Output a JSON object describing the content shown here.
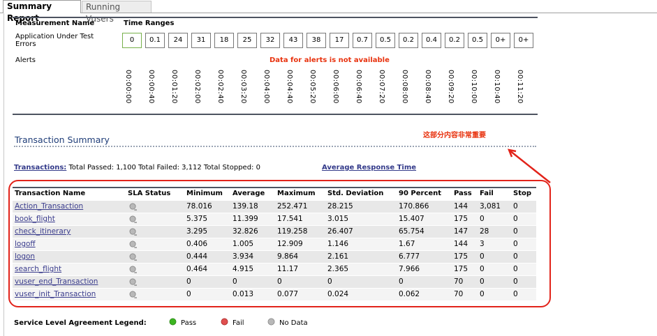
{
  "tabs": [
    {
      "label": "Summary Report",
      "active": true
    },
    {
      "label": "Running Vusers",
      "active": false
    }
  ],
  "measurement": {
    "header_name": "Measurement Name",
    "header_ranges": "Time Ranges",
    "app_errors_label": "Application Under Test\nErrors",
    "values": [
      "0",
      "0.1",
      "24",
      "31",
      "18",
      "25",
      "32",
      "43",
      "38",
      "17",
      "0.7",
      "0.5",
      "0.2",
      "0.4",
      "0.2",
      "0.5",
      "0+",
      "0+"
    ],
    "alerts_label": "Alerts",
    "alerts_message": "Data for alerts is not available",
    "times": [
      "00:00:00",
      "00:00:40",
      "00:01:20",
      "00:02:00",
      "00:02:40",
      "00:03:20",
      "00:04:00",
      "00:04:40",
      "00:05:20",
      "00:06:00",
      "00:06:40",
      "00:07:20",
      "00:08:00",
      "00:08:40",
      "00:09:20",
      "00:10:00",
      "00:10:40",
      "00:11:20"
    ]
  },
  "annotation": "这部分内容非常重要",
  "transaction_summary": {
    "title": "Transaction Summary",
    "transactions_link": "Transactions:",
    "totals": "Total Passed: 1,100 Total Failed: 3,112 Total Stopped: 0",
    "avg_link": "Average Response Time",
    "columns": [
      "Transaction Name",
      "SLA Status",
      "Minimum",
      "Average",
      "Maximum",
      "Std. Deviation",
      "90 Percent",
      "Pass",
      "Fail",
      "Stop"
    ],
    "rows": [
      {
        "name": "Action_Transaction",
        "sla": "no-data",
        "min": "78.016",
        "avg": "139.18",
        "max": "252.471",
        "std": "28.215",
        "p90": "170.866",
        "pass": "144",
        "fail": "3,081",
        "stop": "0"
      },
      {
        "name": "book_flight",
        "sla": "no-data",
        "min": "5.375",
        "avg": "11.399",
        "max": "17.541",
        "std": "3.015",
        "p90": "15.407",
        "pass": "175",
        "fail": "0",
        "stop": "0"
      },
      {
        "name": "check_itinerary",
        "sla": "no-data",
        "min": "3.295",
        "avg": "32.826",
        "max": "119.258",
        "std": "26.407",
        "p90": "65.754",
        "pass": "147",
        "fail": "28",
        "stop": "0"
      },
      {
        "name": "logoff",
        "sla": "no-data",
        "min": "0.406",
        "avg": "1.005",
        "max": "12.909",
        "std": "1.146",
        "p90": "1.67",
        "pass": "144",
        "fail": "3",
        "stop": "0"
      },
      {
        "name": "logon",
        "sla": "no-data",
        "min": "0.444",
        "avg": "3.934",
        "max": "9.864",
        "std": "2.161",
        "p90": "6.777",
        "pass": "175",
        "fail": "0",
        "stop": "0"
      },
      {
        "name": "search_flight",
        "sla": "no-data",
        "min": "0.464",
        "avg": "4.915",
        "max": "11.17",
        "std": "2.365",
        "p90": "7.966",
        "pass": "175",
        "fail": "0",
        "stop": "0"
      },
      {
        "name": "vuser_end_Transaction",
        "sla": "no-data",
        "min": "0",
        "avg": "0",
        "max": "0",
        "std": "0",
        "p90": "0",
        "pass": "70",
        "fail": "0",
        "stop": "0"
      },
      {
        "name": "vuser_init_Transaction",
        "sla": "no-data",
        "min": "0",
        "avg": "0.013",
        "max": "0.077",
        "std": "0.024",
        "p90": "0.062",
        "pass": "70",
        "fail": "0",
        "stop": "0"
      }
    ]
  },
  "legend": {
    "title": "Service Level Agreement Legend:",
    "pass": "Pass",
    "fail": "Fail",
    "nodata": "No Data",
    "colors": {
      "pass": "#3cb521",
      "fail": "#e05050",
      "nodata": "#a0a0a0",
      "annotation": "#e2231a"
    }
  }
}
